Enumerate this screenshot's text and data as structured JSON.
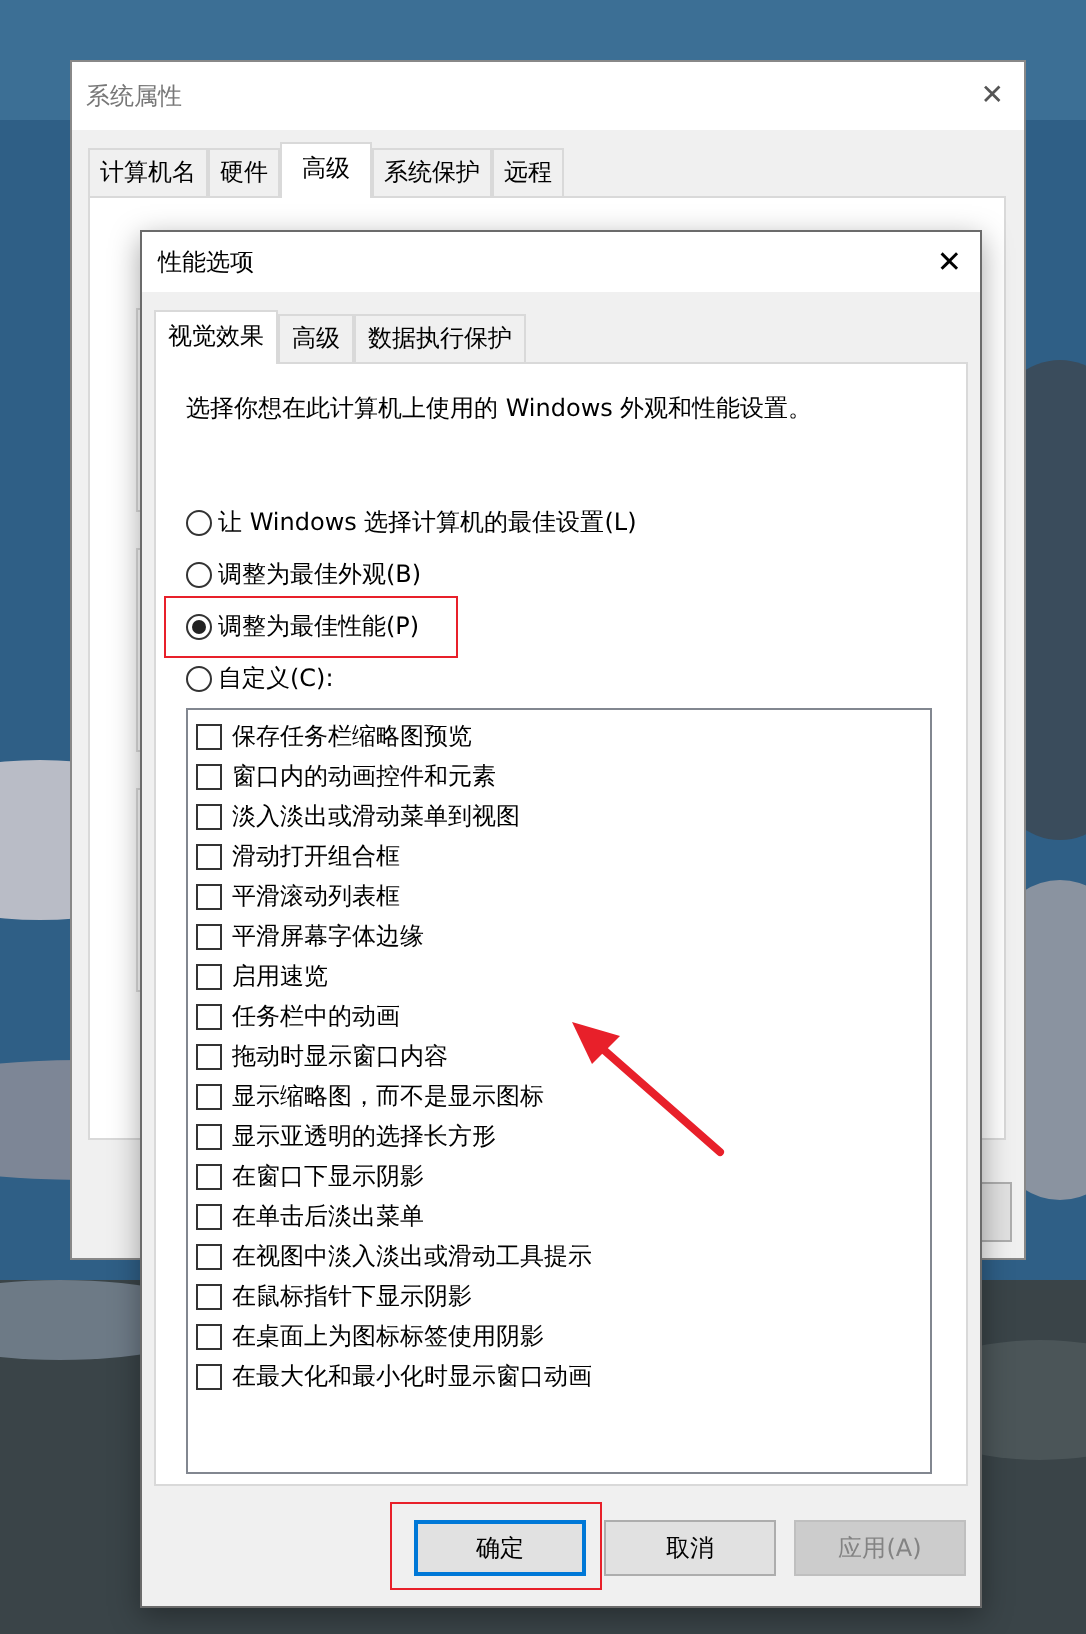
{
  "back_window": {
    "title": "系统属性",
    "close": "✕",
    "tabs": [
      {
        "label": "计算机名",
        "selected": false
      },
      {
        "label": "硬件",
        "selected": false
      },
      {
        "label": "高级",
        "selected": true
      },
      {
        "label": "系统保护",
        "selected": false
      },
      {
        "label": "远程",
        "selected": false
      }
    ]
  },
  "dialog": {
    "title": "性能选项",
    "close": "✕",
    "tabs": [
      {
        "label": "视觉效果",
        "selected": true
      },
      {
        "label": "高级",
        "selected": false
      },
      {
        "label": "数据执行保护",
        "selected": false
      }
    ],
    "description": "选择你想在此计算机上使用的 Windows 外观和性能设置。",
    "options": [
      {
        "label": "让 Windows 选择计算机的最佳设置(L)",
        "selected": false,
        "highlighted": false
      },
      {
        "label": "调整为最佳外观(B)",
        "selected": false,
        "highlighted": false
      },
      {
        "label": "调整为最佳性能(P)",
        "selected": true,
        "highlighted": true
      },
      {
        "label": "自定义(C):",
        "selected": false,
        "highlighted": false
      }
    ],
    "effects_arrow": true,
    "effects": [
      {
        "label": "保存任务栏缩略图预览",
        "checked": false
      },
      {
        "label": "窗口内的动画控件和元素",
        "checked": false
      },
      {
        "label": "淡入淡出或滑动菜单到视图",
        "checked": false
      },
      {
        "label": "滑动打开组合框",
        "checked": false
      },
      {
        "label": "平滑滚动列表框",
        "checked": false
      },
      {
        "label": "平滑屏幕字体边缘",
        "checked": false
      },
      {
        "label": "启用速览",
        "checked": false
      },
      {
        "label": "任务栏中的动画",
        "checked": false
      },
      {
        "label": "拖动时显示窗口内容",
        "checked": false
      },
      {
        "label": "显示缩略图，而不是显示图标",
        "checked": false
      },
      {
        "label": "显示亚透明的选择长方形",
        "checked": false
      },
      {
        "label": "在窗口下显示阴影",
        "checked": false
      },
      {
        "label": "在单击后淡出菜单",
        "checked": false
      },
      {
        "label": "在视图中淡入淡出或滑动工具提示",
        "checked": false
      },
      {
        "label": "在鼠标指针下显示阴影",
        "checked": false
      },
      {
        "label": "在桌面上为图标标签使用阴影",
        "checked": false
      },
      {
        "label": "在最大化和最小化时显示窗口动画",
        "checked": false
      }
    ],
    "buttons": [
      {
        "label": "确定",
        "kind": "default",
        "disabled": false,
        "highlighted": true
      },
      {
        "label": "取消",
        "kind": "normal",
        "disabled": false,
        "highlighted": false
      },
      {
        "label": "应用(A)",
        "kind": "normal",
        "disabled": true,
        "highlighted": false
      }
    ]
  }
}
